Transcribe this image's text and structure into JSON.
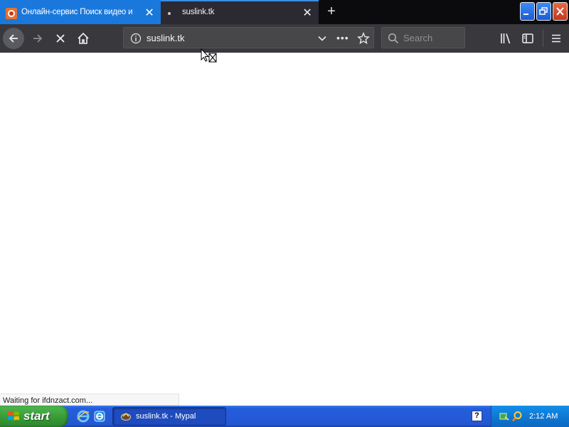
{
  "browser": {
    "tabs": [
      {
        "title": "Онлайн-сервис Поиск видео и с",
        "active": false,
        "close": "✕"
      },
      {
        "title": "suslink.tk",
        "active": true,
        "close": "✕"
      }
    ],
    "new_tab": "+",
    "address": {
      "url": "suslink.tk",
      "more": "•••"
    },
    "search": {
      "placeholder": "Search"
    },
    "status": "Waiting for ifdnzact.com..."
  },
  "taskbar": {
    "start_label": "start",
    "task_title": "suslink.tk - Mypal",
    "help_label": "?",
    "clock": "2:12 AM"
  },
  "colors": {
    "tab_active_blue": "#1a78dc",
    "toolbar": "#38383d",
    "taskbar_blue": "#245edc",
    "start_green": "#379b37",
    "tray_blue": "#0f79d4"
  },
  "icons": [
    "favicon-icon",
    "close-icon",
    "plus-icon",
    "back-icon",
    "forward-icon",
    "stop-icon",
    "home-icon",
    "info-icon",
    "chevron-down-icon",
    "more-icon",
    "star-icon",
    "search-icon",
    "library-icon",
    "sidebar-icon",
    "menu-icon",
    "windows-flag-icon",
    "ie-icon",
    "help-icon",
    "network-icon"
  ]
}
